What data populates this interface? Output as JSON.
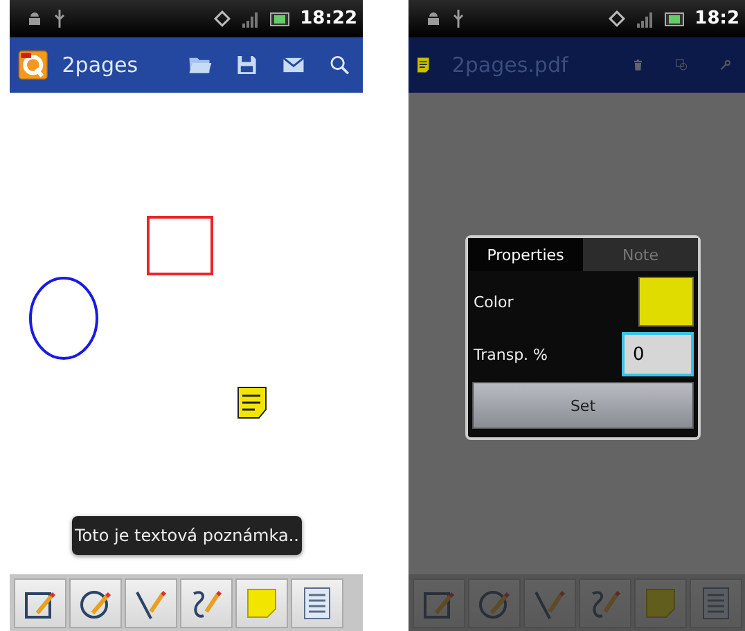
{
  "phones": [
    {
      "kind": "viewer",
      "status_bar": {
        "time": "18:22"
      },
      "action_bar": {
        "title": "2pages"
      },
      "annotations": [
        {
          "kind": "rectangle",
          "color": "#e8262a"
        },
        {
          "kind": "ellipse",
          "color": "#1a1ae6"
        },
        {
          "kind": "note",
          "color": "#f2e600"
        }
      ],
      "toast": "Toto je textová poznámka.."
    },
    {
      "kind": "annotation-edit",
      "status_bar": {
        "time": "18:2"
      },
      "action_bar": {
        "title": "2pages.pdf"
      },
      "dialog": {
        "tabs": [
          {
            "label": "Properties",
            "selected": true
          },
          {
            "label": "Note",
            "selected": false
          }
        ],
        "color_label": "Color",
        "color": "#e0dc00",
        "transparency_label": "Transp. %",
        "transparency_value": "0",
        "button": "Set"
      }
    }
  ]
}
